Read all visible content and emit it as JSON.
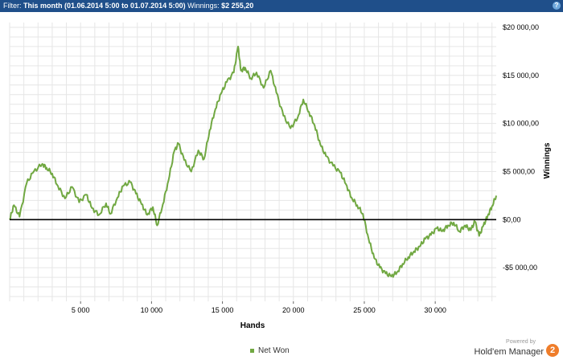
{
  "filter": {
    "label": "Filter:",
    "value": "This month (01.06.2014 5:00 to 01.07.2014 5:00)",
    "winnings_label": "Winnings:",
    "winnings_value": "$2 255,20"
  },
  "help_glyph": "?",
  "brand": {
    "powered_by": "Powered by",
    "name": "Hold'em Manager",
    "logo_glyph": "2",
    "logo_color": "#ef7d2a"
  },
  "chart_data": {
    "type": "line",
    "xlabel": "Hands",
    "ylabel": "Winnings",
    "xlim": [
      0,
      34300
    ],
    "ylim": [
      -8500,
      20500
    ],
    "x_ticks": [
      5000,
      10000,
      15000,
      20000,
      25000,
      30000
    ],
    "x_tick_labels": [
      "5 000",
      "10 000",
      "15 000",
      "20 000",
      "25 000",
      "30 000"
    ],
    "y_ticks": [
      -5000,
      0,
      5000,
      10000,
      15000,
      20000
    ],
    "y_tick_labels": [
      "-$5 000,00",
      "$0,00",
      "$5 000,00",
      "$10 000,00",
      "$15 000,00",
      "$20 000,00"
    ],
    "grid": true,
    "legend_position": "bottom",
    "series": [
      {
        "name": "Net Won",
        "color": "#71a842",
        "x": [
          0,
          300,
          700,
          1200,
          1700,
          2300,
          2600,
          3000,
          3400,
          3900,
          4400,
          4900,
          5400,
          5800,
          6300,
          6800,
          7100,
          7600,
          8000,
          8500,
          8900,
          9300,
          9700,
          10100,
          10400,
          10800,
          11200,
          11600,
          11900,
          12300,
          12800,
          13300,
          13700,
          14100,
          14500,
          14900,
          15300,
          15800,
          16100,
          16300,
          16600,
          17000,
          17400,
          17900,
          18400,
          18800,
          19300,
          19800,
          20300,
          20700,
          21100,
          21500,
          21900,
          22300,
          22800,
          23300,
          23700,
          24100,
          24500,
          24900,
          25300,
          25700,
          26100,
          26500,
          26900,
          27300,
          27700,
          28100,
          28500,
          28900,
          29300,
          29700,
          30100,
          30500,
          30900,
          31300,
          31700,
          32100,
          32500,
          32800,
          33100,
          33400,
          33700,
          34000,
          34300
        ],
        "values": [
          0,
          1500,
          300,
          3800,
          5000,
          5800,
          5400,
          4800,
          3500,
          2200,
          3400,
          1800,
          2600,
          1200,
          500,
          1700,
          600,
          2300,
          3500,
          3900,
          2700,
          1600,
          500,
          1300,
          -600,
          1600,
          4100,
          7100,
          7900,
          6200,
          5000,
          7200,
          6300,
          9300,
          11500,
          13100,
          14300,
          15300,
          18000,
          15500,
          15800,
          14700,
          15300,
          13700,
          15500,
          13200,
          10800,
          9500,
          10600,
          12500,
          11200,
          9800,
          7800,
          6600,
          5600,
          4900,
          3700,
          2300,
          1500,
          600,
          -2000,
          -4000,
          -5000,
          -5600,
          -5900,
          -5500,
          -4600,
          -3900,
          -3300,
          -2800,
          -2000,
          -1600,
          -900,
          -1200,
          -600,
          -300,
          -1200,
          -600,
          -1100,
          -200,
          -1700,
          -600,
          400,
          1400,
          2500
        ]
      }
    ]
  }
}
